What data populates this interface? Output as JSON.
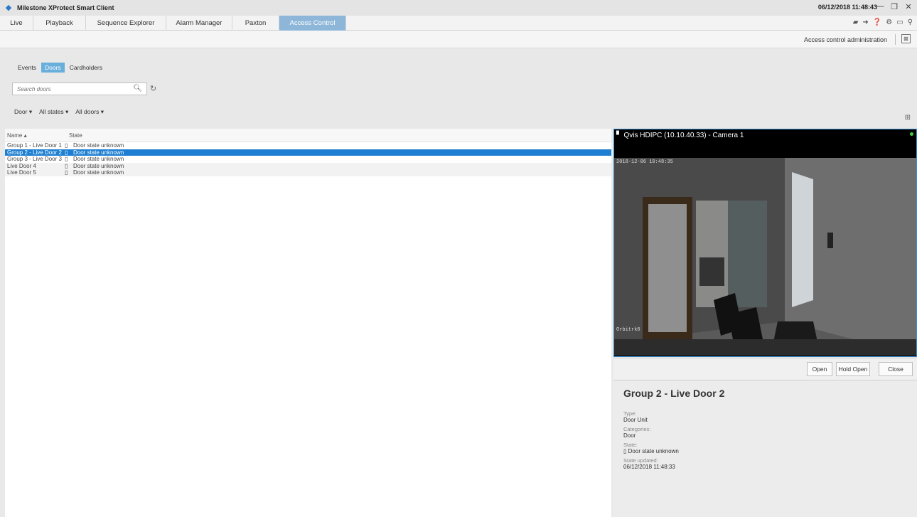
{
  "window": {
    "title": "Milestone XProtect Smart Client",
    "clock": "06/12/2018 11:48:43"
  },
  "tabs": [
    {
      "label": "Live"
    },
    {
      "label": "Playback"
    },
    {
      "label": "Sequence Explorer"
    },
    {
      "label": "Alarm Manager"
    },
    {
      "label": "Paxton"
    },
    {
      "label": "Access Control"
    }
  ],
  "admin": {
    "link": "Access control administration"
  },
  "subtabs": [
    {
      "label": "Events"
    },
    {
      "label": "Doors"
    },
    {
      "label": "Cardholders"
    }
  ],
  "search": {
    "placeholder": "Search doors"
  },
  "filters": {
    "type": "Door",
    "states": "All states",
    "doors": "All doors"
  },
  "table": {
    "columns": [
      "Name",
      "State"
    ],
    "rows": [
      {
        "name": "Group 1 - Live Door 1",
        "state": "Door state unknown"
      },
      {
        "name": "Group 2 - Live Door 2",
        "state": "Door state unknown"
      },
      {
        "name": "Group 3 - Live Door 3",
        "state": "Door state unknown"
      },
      {
        "name": "Live Door 4",
        "state": "Door state unknown"
      },
      {
        "name": "Live Door 5",
        "state": "Door state unknown"
      }
    ]
  },
  "camera": {
    "title": "Qvis HDIPC (10.10.40.33) - Camera 1",
    "timestamp": "2018-12-06 10:48:35",
    "label": "Orbitrk0"
  },
  "actions": {
    "open": "Open",
    "hold_open": "Hold Open",
    "close": "Close"
  },
  "details": {
    "title": "Group 2 - Live Door 2",
    "type_label": "Type:",
    "type_value": "Door Unit",
    "categories_label": "Categories:",
    "categories_value": "Door",
    "state_label": "State:",
    "state_value": "Door state unknown",
    "updated_label": "State updated:",
    "updated_value": "06/12/2018 11:48:33"
  },
  "colors": {
    "accent": "#1e7fd2",
    "active_tab": "#8db6d9",
    "active_subtab": "#6aaedc"
  }
}
